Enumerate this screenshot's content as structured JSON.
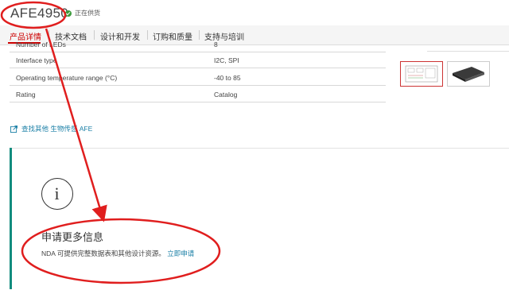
{
  "header": {
    "part_number": "AFE4950",
    "status": "正在供货"
  },
  "nav": {
    "items": [
      {
        "label": "产品详情"
      },
      {
        "label": "技术文档"
      },
      {
        "label": "设计和开发"
      },
      {
        "label": "订购和质量"
      },
      {
        "label": "支持与培训"
      }
    ]
  },
  "specs": {
    "rows": [
      {
        "name": "Number of LEDs",
        "value": "8"
      },
      {
        "name": "Interface type",
        "value": "I2C, SPI"
      },
      {
        "name": "Operating temperature range (°C)",
        "value": "-40 to 85"
      },
      {
        "name": "Rating",
        "value": "Catalog"
      }
    ]
  },
  "links": {
    "find_other": "查找其他 生物传感 AFE"
  },
  "request": {
    "title": "申请更多信息",
    "description": "NDA 可提供完整数据表和其他设计资源。",
    "link": "立即申请"
  },
  "colors": {
    "accent_red": "#cc0000",
    "link_blue": "#1a7fa6",
    "annotation_red": "#e01e1e",
    "panel_bar": "#128c7e"
  }
}
